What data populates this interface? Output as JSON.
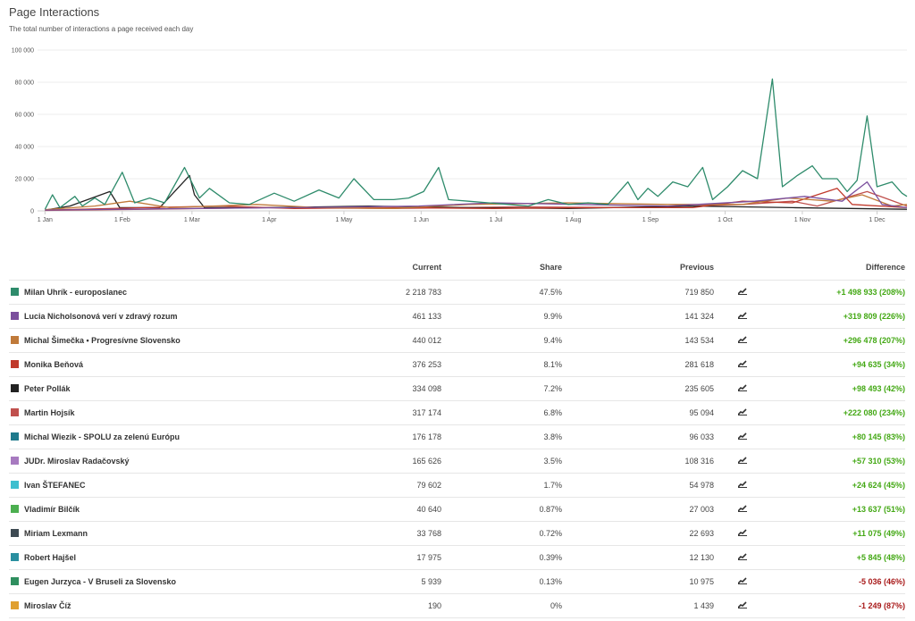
{
  "header": {
    "title": "Page Interactions",
    "subtitle": "The total number of interactions a page received each day"
  },
  "chart_data": {
    "type": "line",
    "title": "Page Interactions",
    "subtitle": "The total number of interactions a page received each day",
    "xlabel": "",
    "ylabel": "",
    "ylim": [
      0,
      100000
    ],
    "y_ticks": [
      0,
      20000,
      40000,
      60000,
      80000,
      100000
    ],
    "y_tick_labels": [
      "0",
      "20 000",
      "40 000",
      "60 000",
      "80 000",
      "100 000"
    ],
    "x_tick_labels": [
      "1 Jan",
      "1 Feb",
      "1 Mar",
      "1 Apr",
      "1 May",
      "1 Jun",
      "1 Jul",
      "1 Aug",
      "1 Sep",
      "1 Oct",
      "1 Nov",
      "1 Dec"
    ],
    "x_tick_days": [
      0,
      31,
      59,
      90,
      120,
      151,
      181,
      212,
      243,
      273,
      304,
      334
    ],
    "xlim_days": [
      -3,
      346
    ],
    "grid": true,
    "legend": "none",
    "series": [
      {
        "name": "Milan Uhrík - europoslanec",
        "color": "#2e8b6b",
        "points": [
          [
            0,
            1000
          ],
          [
            3,
            10000
          ],
          [
            6,
            2000
          ],
          [
            12,
            9000
          ],
          [
            15,
            3000
          ],
          [
            20,
            8000
          ],
          [
            24,
            4000
          ],
          [
            31,
            24000
          ],
          [
            36,
            5000
          ],
          [
            42,
            8000
          ],
          [
            48,
            5000
          ],
          [
            56,
            27000
          ],
          [
            62,
            8000
          ],
          [
            66,
            14000
          ],
          [
            74,
            5000
          ],
          [
            82,
            4000
          ],
          [
            92,
            11000
          ],
          [
            100,
            6000
          ],
          [
            110,
            13000
          ],
          [
            118,
            8000
          ],
          [
            124,
            20000
          ],
          [
            132,
            7000
          ],
          [
            140,
            7000
          ],
          [
            146,
            8000
          ],
          [
            152,
            12000
          ],
          [
            158,
            27000
          ],
          [
            162,
            7000
          ],
          [
            170,
            6000
          ],
          [
            178,
            5000
          ],
          [
            186,
            4000
          ],
          [
            194,
            3000
          ],
          [
            202,
            7000
          ],
          [
            210,
            4000
          ],
          [
            218,
            5000
          ],
          [
            226,
            4000
          ],
          [
            234,
            18000
          ],
          [
            238,
            7000
          ],
          [
            242,
            14000
          ],
          [
            246,
            9000
          ],
          [
            252,
            18000
          ],
          [
            258,
            15000
          ],
          [
            264,
            27000
          ],
          [
            268,
            7000
          ],
          [
            274,
            15000
          ],
          [
            280,
            25000
          ],
          [
            286,
            20000
          ],
          [
            292,
            82000
          ],
          [
            296,
            15000
          ],
          [
            302,
            22000
          ],
          [
            308,
            28000
          ],
          [
            312,
            20000
          ],
          [
            318,
            20000
          ],
          [
            322,
            12000
          ],
          [
            326,
            19000
          ],
          [
            330,
            59000
          ],
          [
            334,
            15000
          ],
          [
            340,
            18000
          ],
          [
            344,
            11000
          ],
          [
            346,
            9000
          ]
        ]
      },
      {
        "name": "Lucia Nicholsonová verí v zdravý rozum",
        "color": "#7b4f9d",
        "points": [
          [
            0,
            500
          ],
          [
            30,
            1000
          ],
          [
            60,
            1500
          ],
          [
            100,
            2000
          ],
          [
            150,
            3000
          ],
          [
            180,
            5000
          ],
          [
            215,
            4000
          ],
          [
            250,
            3000
          ],
          [
            285,
            6000
          ],
          [
            305,
            9000
          ],
          [
            320,
            6000
          ],
          [
            330,
            18000
          ],
          [
            336,
            4000
          ],
          [
            346,
            2000
          ]
        ]
      },
      {
        "name": "Michal Šimečka • Progresívne Slovensko",
        "color": "#c07a3a",
        "points": [
          [
            0,
            800
          ],
          [
            20,
            3000
          ],
          [
            34,
            6000
          ],
          [
            50,
            2000
          ],
          [
            85,
            4000
          ],
          [
            110,
            2000
          ],
          [
            140,
            1500
          ],
          [
            170,
            4000
          ],
          [
            210,
            5000
          ],
          [
            250,
            4000
          ],
          [
            280,
            4000
          ],
          [
            298,
            8000
          ],
          [
            316,
            6000
          ],
          [
            328,
            10000
          ],
          [
            340,
            3000
          ],
          [
            346,
            4000
          ]
        ]
      },
      {
        "name": "Monika Beňová",
        "color": "#c0392b",
        "points": [
          [
            0,
            500
          ],
          [
            40,
            2000
          ],
          [
            70,
            3000
          ],
          [
            100,
            1500
          ],
          [
            140,
            2000
          ],
          [
            180,
            1500
          ],
          [
            220,
            2000
          ],
          [
            260,
            2000
          ],
          [
            280,
            6000
          ],
          [
            300,
            5000
          ],
          [
            318,
            14000
          ],
          [
            324,
            4000
          ],
          [
            346,
            2000
          ]
        ]
      },
      {
        "name": "Peter Pollák",
        "color": "#222222",
        "points": [
          [
            0,
            500
          ],
          [
            10,
            3000
          ],
          [
            26,
            12000
          ],
          [
            30,
            2000
          ],
          [
            46,
            2000
          ],
          [
            58,
            22000
          ],
          [
            60,
            10000
          ],
          [
            64,
            2000
          ],
          [
            90,
            2000
          ],
          [
            130,
            3000
          ],
          [
            170,
            2000
          ],
          [
            210,
            1500
          ],
          [
            260,
            3000
          ],
          [
            300,
            2000
          ],
          [
            346,
            1000
          ]
        ]
      },
      {
        "name": "Martin Hojsík",
        "color": "#c0504d",
        "points": [
          [
            0,
            300
          ],
          [
            40,
            1000
          ],
          [
            90,
            2000
          ],
          [
            140,
            1500
          ],
          [
            190,
            2500
          ],
          [
            240,
            2000
          ],
          [
            280,
            4000
          ],
          [
            300,
            6000
          ],
          [
            310,
            3000
          ],
          [
            330,
            12000
          ],
          [
            346,
            3000
          ]
        ]
      }
    ]
  },
  "table": {
    "headers": {
      "name": "",
      "current": "Current",
      "share": "Share",
      "previous": "Previous",
      "trend": "",
      "difference": "Difference"
    },
    "rows": [
      {
        "name": "Milan Uhrík - europoslanec",
        "color": "#2e8b6b",
        "current": "2 218 783",
        "share": "47.5%",
        "previous": "719 850",
        "difference": "+1 498 933 (208%)",
        "positive": true
      },
      {
        "name": "Lucia Nicholsonová verí v zdravý rozum",
        "color": "#7b4f9d",
        "current": "461 133",
        "share": "9.9%",
        "previous": "141 324",
        "difference": "+319 809 (226%)",
        "positive": true
      },
      {
        "name": "Michal Šimečka • Progresívne Slovensko",
        "color": "#c07a3a",
        "current": "440 012",
        "share": "9.4%",
        "previous": "143 534",
        "difference": "+296 478 (207%)",
        "positive": true
      },
      {
        "name": "Monika Beňová",
        "color": "#c0392b",
        "current": "376 253",
        "share": "8.1%",
        "previous": "281 618",
        "difference": "+94 635 (34%)",
        "positive": true
      },
      {
        "name": "Peter Pollák",
        "color": "#222222",
        "current": "334 098",
        "share": "7.2%",
        "previous": "235 605",
        "difference": "+98 493 (42%)",
        "positive": true
      },
      {
        "name": "Martin Hojsík",
        "color": "#c0504d",
        "current": "317 174",
        "share": "6.8%",
        "previous": "95 094",
        "difference": "+222 080 (234%)",
        "positive": true
      },
      {
        "name": "Michal Wiezik - SPOLU za zelenú Európu",
        "color": "#1f7a8c",
        "current": "176 178",
        "share": "3.8%",
        "previous": "96 033",
        "difference": "+80 145 (83%)",
        "positive": true
      },
      {
        "name": "JUDr. Miroslav Radačovský",
        "color": "#a77ac0",
        "current": "165 626",
        "share": "3.5%",
        "previous": "108 316",
        "difference": "+57 310 (53%)",
        "positive": true
      },
      {
        "name": "Ivan ŠTEFANEC",
        "color": "#3fbfcf",
        "current": "79 602",
        "share": "1.7%",
        "previous": "54 978",
        "difference": "+24 624 (45%)",
        "positive": true
      },
      {
        "name": "Vladimír Bilčík",
        "color": "#4caf50",
        "current": "40 640",
        "share": "0.87%",
        "previous": "27 003",
        "difference": "+13 637 (51%)",
        "positive": true
      },
      {
        "name": "Miriam Lexmann",
        "color": "#3d4a52",
        "current": "33 768",
        "share": "0.72%",
        "previous": "22 693",
        "difference": "+11 075 (49%)",
        "positive": true
      },
      {
        "name": "Robert Hajšel",
        "color": "#2a8fa0",
        "current": "17 975",
        "share": "0.39%",
        "previous": "12 130",
        "difference": "+5 845 (48%)",
        "positive": true
      },
      {
        "name": "Eugen Jurzyca - V Bruseli za Slovensko",
        "color": "#2f8f5f",
        "current": "5 939",
        "share": "0.13%",
        "previous": "10 975",
        "difference": "-5 036 (46%)",
        "positive": false
      },
      {
        "name": "Miroslav Číž",
        "color": "#e0a030",
        "current": "190",
        "share": "0%",
        "previous": "1 439",
        "difference": "-1 249 (87%)",
        "positive": false
      }
    ]
  }
}
